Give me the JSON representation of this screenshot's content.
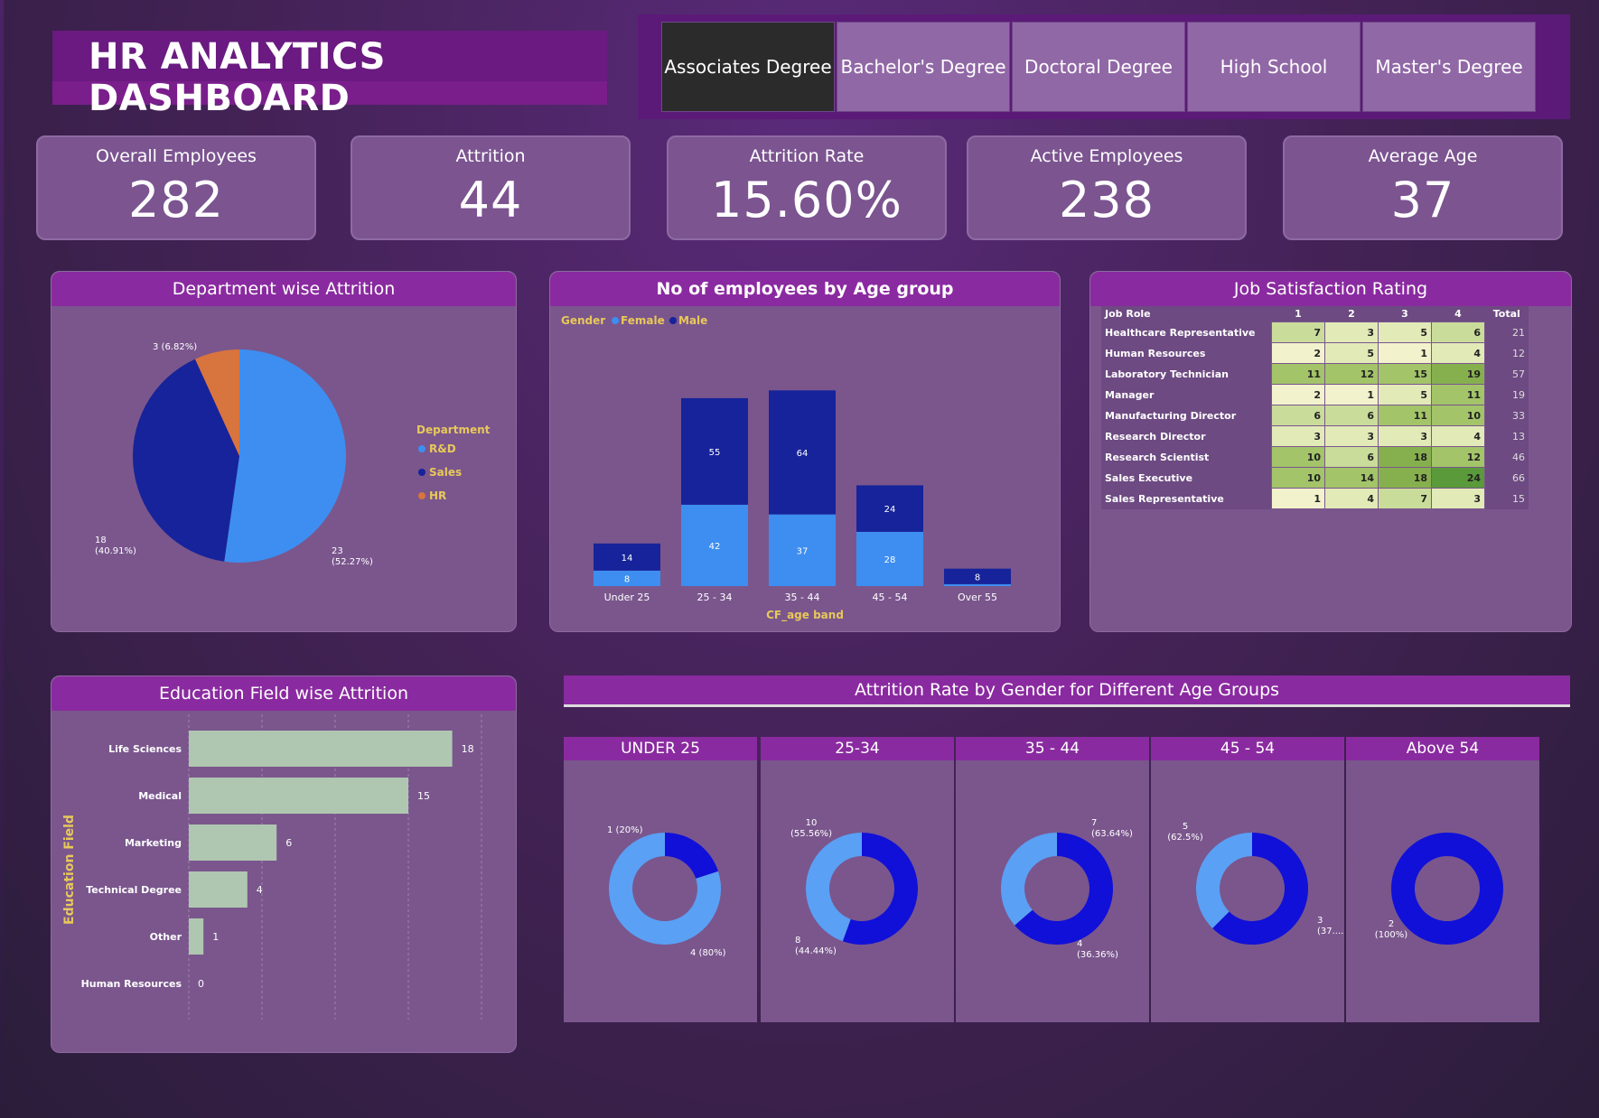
{
  "header": {
    "title": "HR ANALYTICS DASHBOARD"
  },
  "slicer": {
    "options": [
      "Associates Degree",
      "Bachelor's Degree",
      "Doctoral Degree",
      "High School",
      "Master's Degree"
    ],
    "selected": "Associates Degree"
  },
  "kpis": [
    {
      "label": "Overall Employees",
      "value": "282"
    },
    {
      "label": "Attrition",
      "value": "44"
    },
    {
      "label": "Attrition Rate",
      "value": "15.60%"
    },
    {
      "label": "Active Employees",
      "value": "238"
    },
    {
      "label": "Average Age",
      "value": "37"
    }
  ],
  "colors": {
    "rnd": "#3d8ef0",
    "sales": "#16239a",
    "hr": "#d8743e",
    "female": "#3d8ef0",
    "male": "#16239a",
    "bar": "#afc7b0",
    "donut_light": "#5aa0f5",
    "donut_dark": "#1010d8"
  },
  "chart_data": [
    {
      "type": "pie",
      "title": "Department wise Attrition",
      "legend_title": "Department",
      "legend_position": "right",
      "slices": [
        {
          "name": "R&D",
          "value": 23,
          "label": "23\n(52.27%)"
        },
        {
          "name": "Sales",
          "value": 18,
          "label": "18\n(40.91%)"
        },
        {
          "name": "HR",
          "value": 3,
          "label": "3 (6.82%)"
        }
      ]
    },
    {
      "type": "bar",
      "stacked": true,
      "title": "No of employees by Age group",
      "legend_title": "Gender",
      "legend_position": "top-left",
      "xlabel": "CF_age band",
      "categories": [
        "Under 25",
        "25 - 34",
        "35 - 44",
        "45 - 54",
        "Over 55"
      ],
      "series": [
        {
          "name": "Female",
          "values": [
            8,
            42,
            37,
            28,
            1
          ]
        },
        {
          "name": "Male",
          "values": [
            14,
            55,
            64,
            24,
            8
          ]
        }
      ],
      "value_labels": {
        "Female": [
          "8",
          "42",
          "37",
          "28",
          ""
        ],
        "Male": [
          "14",
          "55",
          "64",
          "24",
          "8"
        ]
      }
    },
    {
      "type": "table",
      "title": "Job Satisfaction Rating",
      "columns": [
        "Job Role",
        "1",
        "2",
        "3",
        "4",
        "Total"
      ],
      "rows": [
        {
          "role": "Healthcare Representative",
          "values": [
            7,
            3,
            5,
            6
          ],
          "total": 21
        },
        {
          "role": "Human Resources",
          "values": [
            2,
            5,
            1,
            4
          ],
          "total": 12
        },
        {
          "role": "Laboratory Technician",
          "values": [
            11,
            12,
            15,
            19
          ],
          "total": 57
        },
        {
          "role": "Manager",
          "values": [
            2,
            1,
            5,
            11
          ],
          "total": 19
        },
        {
          "role": "Manufacturing Director",
          "values": [
            6,
            6,
            11,
            10
          ],
          "total": 33
        },
        {
          "role": "Research Director",
          "values": [
            3,
            3,
            3,
            4
          ],
          "total": 13
        },
        {
          "role": "Research Scientist",
          "values": [
            10,
            6,
            18,
            12
          ],
          "total": 46
        },
        {
          "role": "Sales Executive",
          "values": [
            10,
            14,
            18,
            24
          ],
          "total": 66
        },
        {
          "role": "Sales Representative",
          "values": [
            1,
            4,
            7,
            3
          ],
          "total": 15
        }
      ]
    },
    {
      "type": "bar",
      "orientation": "horizontal",
      "title": "Education Field wise Attrition",
      "ylabel": "Education Field",
      "categories": [
        "Life Sciences",
        "Medical",
        "Marketing",
        "Technical Degree",
        "Other",
        "Human Resources"
      ],
      "values": [
        18,
        15,
        6,
        4,
        1,
        0
      ],
      "xlim": [
        0,
        20
      ]
    },
    {
      "type": "pie",
      "donut": true,
      "title": "Attrition Rate by Gender for Different Age Groups",
      "groups": [
        {
          "name": "UNDER 25",
          "slices": [
            {
              "value": 1,
              "label": "1 (20%)",
              "shade": "dark"
            },
            {
              "value": 4,
              "label": "4 (80%)",
              "shade": "light"
            }
          ]
        },
        {
          "name": "25-34",
          "slices": [
            {
              "value": 10,
              "label": "10\n(55.56%)",
              "shade": "dark"
            },
            {
              "value": 8,
              "label": "8\n(44.44%)",
              "shade": "light"
            }
          ]
        },
        {
          "name": "35 - 44",
          "slices": [
            {
              "value": 7,
              "label": "7\n(63.64%)",
              "shade": "dark"
            },
            {
              "value": 4,
              "label": "4\n(36.36%)",
              "shade": "light"
            }
          ]
        },
        {
          "name": "45 - 54",
          "slices": [
            {
              "value": 5,
              "label": "5\n(62.5%)",
              "shade": "dark"
            },
            {
              "value": 3,
              "label": "3\n(37....)",
              "shade": "light"
            }
          ]
        },
        {
          "name": "Above 54",
          "slices": [
            {
              "value": 2,
              "label": "2\n(100%)",
              "shade": "dark"
            }
          ]
        }
      ]
    }
  ]
}
